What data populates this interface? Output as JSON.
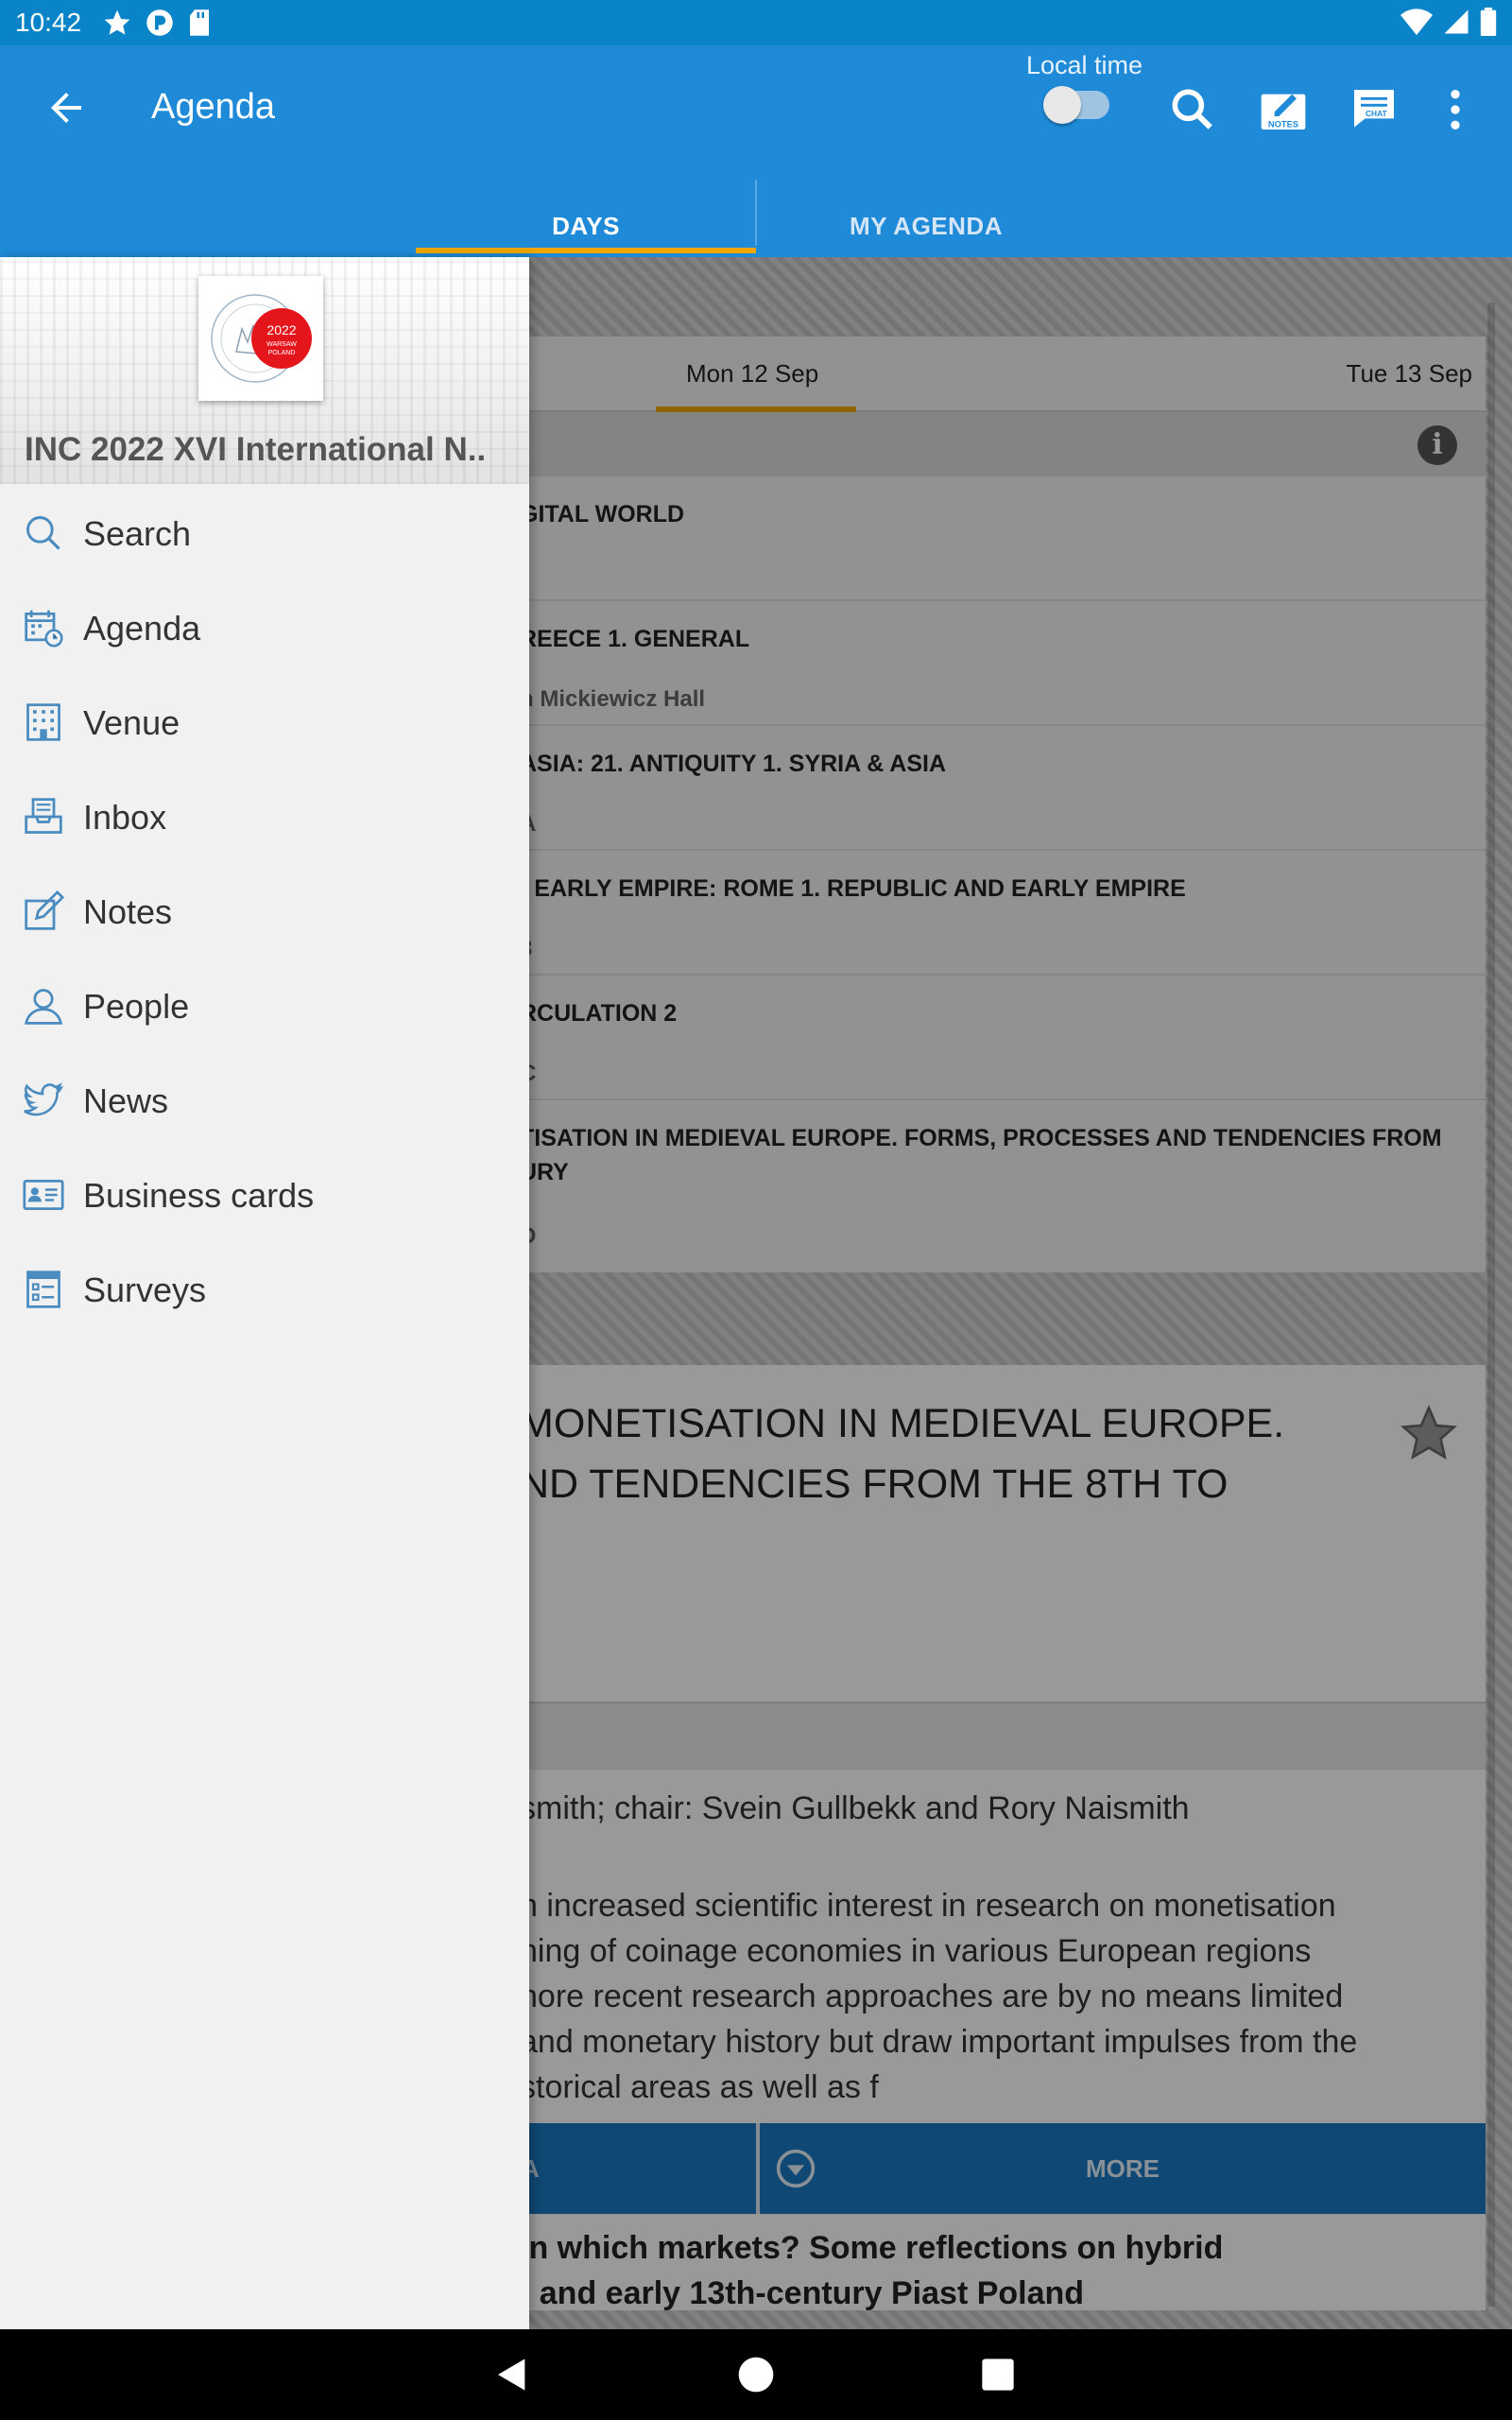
{
  "status_bar": {
    "time": "10:42"
  },
  "app_bar": {
    "title": "Agenda",
    "local_time_label": "Local time",
    "notes_icon_label": "NOTES",
    "chat_icon_label": "CHAT",
    "accent": "#1e8ad8"
  },
  "tabs": [
    {
      "label": "DAYS",
      "selected": true
    },
    {
      "label": "MY AGENDA",
      "selected": false
    }
  ],
  "day_tabs": [
    {
      "label": "Mon 12 Sep",
      "selected": true
    },
    {
      "label": "Tue 13 Sep",
      "selected": false
    }
  ],
  "sessions": [
    {
      "title": "GITAL WORLD",
      "room": ""
    },
    {
      "title": "REECE 1. GENERAL",
      "room": "n Mickiewicz Hall"
    },
    {
      "title": "ASIA: 21. ANTIQUITY 1. SYRIA & ASIA",
      "room": "A"
    },
    {
      "title": ") EARLY EMPIRE: ROME 1. REPUBLIC AND EARLY EMPIRE",
      "room": "3"
    },
    {
      "title": "RCULATION 2",
      "room": "C"
    },
    {
      "title": "TISATION IN MEDIEVAL EUROPE. FORMS, PROCESSES AND TENDENCIES FROM\nURY",
      "room": "D"
    }
  ],
  "detail": {
    "title_line1": "MONETISATION IN MEDIEVAL EUROPE.",
    "title_line2": "ND TENDENCIES FROM THE 8TH TO",
    "chair": "smith; chair: Svein Gullbekk and Rory Naismith",
    "abstract": "n increased scientific interest in research on monetisation\nning of coinage economies in various European regions\nnore recent research approaches are by no means limited\nand monetary history but draw important impulses from the\nstorical areas as well as f",
    "button_left": "A",
    "button_more": "MORE",
    "paper_line1": "in which markets? Some reflections on hybrid",
    "paper_line2": "- and early 13th-century Piast Poland"
  },
  "drawer": {
    "event_title": "INC 2022 XVI International N..",
    "logo_text_year": "2022",
    "logo_text_city": "WARSAW",
    "logo_text_country": "POLAND",
    "items": [
      {
        "label": "Search",
        "icon": "search-icon"
      },
      {
        "label": "Agenda",
        "icon": "calendar-icon"
      },
      {
        "label": "Venue",
        "icon": "building-icon"
      },
      {
        "label": "Inbox",
        "icon": "inbox-icon"
      },
      {
        "label": "Notes",
        "icon": "notes-icon"
      },
      {
        "label": "People",
        "icon": "person-icon"
      },
      {
        "label": "News",
        "icon": "twitter-bird-icon"
      },
      {
        "label": "Business cards",
        "icon": "business-card-icon"
      },
      {
        "label": "Surveys",
        "icon": "survey-icon"
      }
    ]
  }
}
